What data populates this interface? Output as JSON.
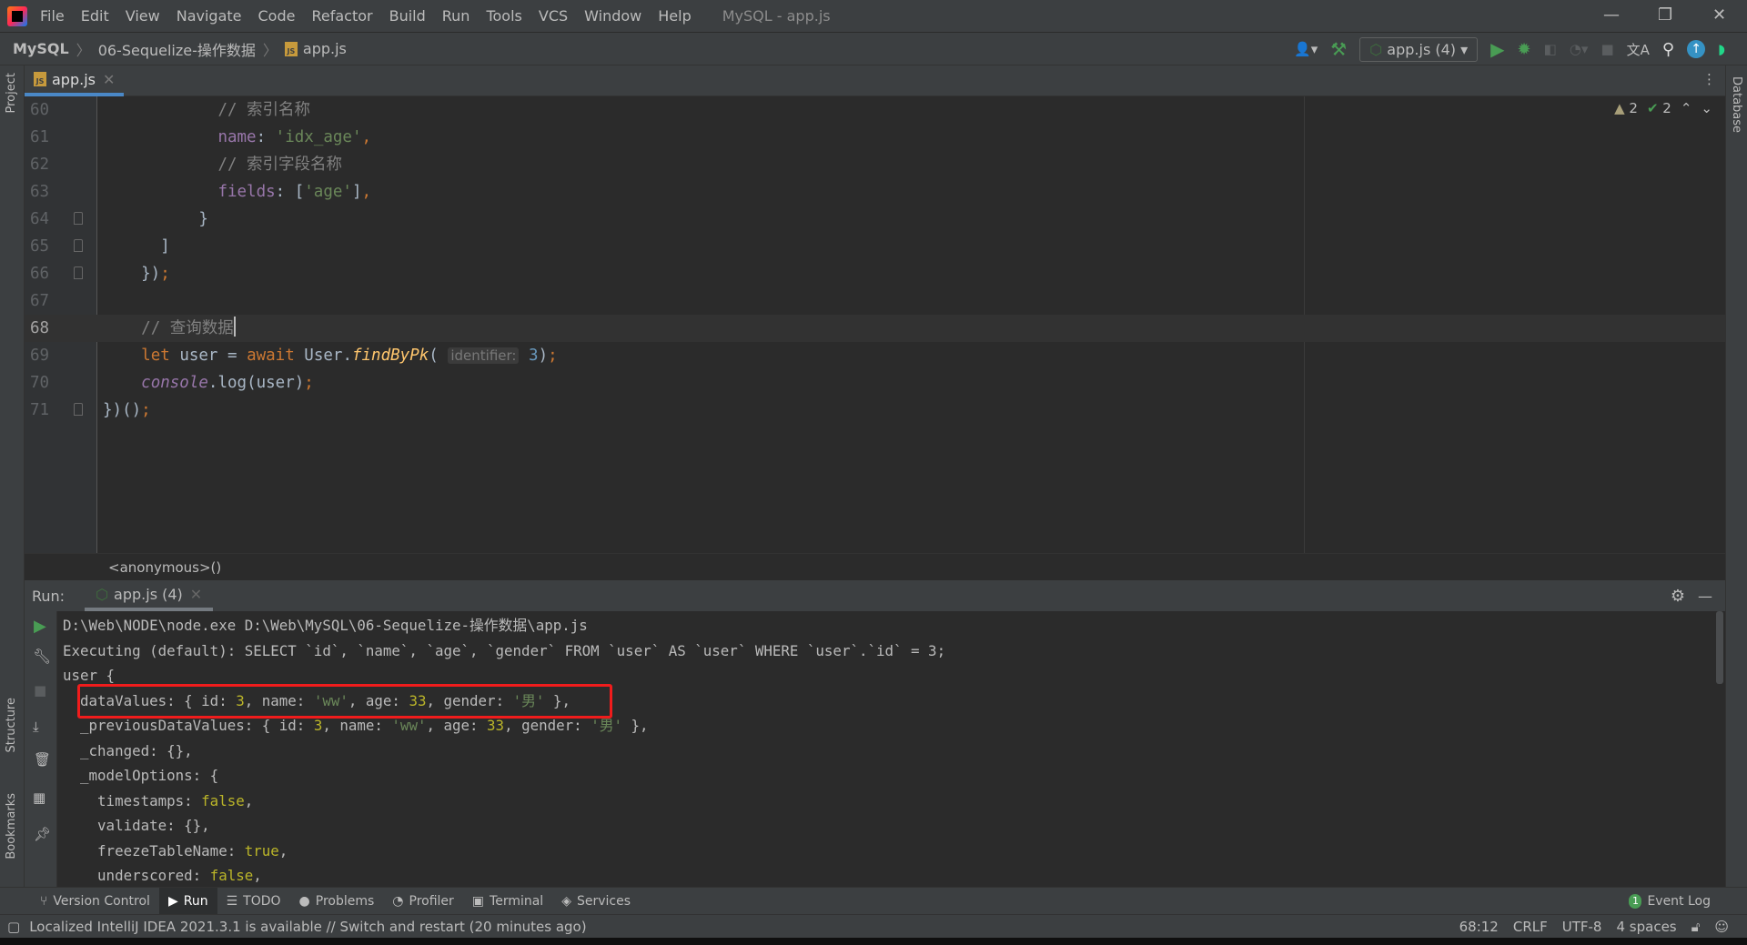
{
  "window": {
    "title": "MySQL - app.js"
  },
  "menu": [
    "File",
    "Edit",
    "View",
    "Navigate",
    "Code",
    "Refactor",
    "Build",
    "Run",
    "Tools",
    "VCS",
    "Window",
    "Help"
  ],
  "breadcrumb": [
    "MySQL",
    "06-Sequelize-操作数据",
    "app.js"
  ],
  "run_config": "app.js (4)",
  "editor_tab": "app.js",
  "side_labels": {
    "project": "Project",
    "structure": "Structure",
    "bookmarks": "Bookmarks",
    "database": "Database"
  },
  "inspections": {
    "warnings": "2",
    "ok": "2"
  },
  "code_lines": [
    {
      "n": "60",
      "tokens": [
        [
          "            ",
          "t-pl"
        ],
        [
          "// 索引名称",
          "t-cm"
        ]
      ]
    },
    {
      "n": "61",
      "tokens": [
        [
          "            ",
          "t-pl"
        ],
        [
          "name",
          "t-pr"
        ],
        [
          ": ",
          "t-pl"
        ],
        [
          "'idx_age'",
          "t-st"
        ],
        [
          ",",
          "t-kw"
        ]
      ]
    },
    {
      "n": "62",
      "tokens": [
        [
          "            ",
          "t-pl"
        ],
        [
          "// 索引字段名称",
          "t-cm"
        ]
      ]
    },
    {
      "n": "63",
      "tokens": [
        [
          "            ",
          "t-pl"
        ],
        [
          "fields",
          "t-pr"
        ],
        [
          ": [",
          "t-pl"
        ],
        [
          "'age'",
          "t-st"
        ],
        [
          "]",
          "t-pl"
        ],
        [
          ",",
          "t-kw"
        ]
      ]
    },
    {
      "n": "64",
      "tokens": [
        [
          "          }",
          "t-pl"
        ]
      ]
    },
    {
      "n": "65",
      "tokens": [
        [
          "      ]",
          "t-pl"
        ]
      ]
    },
    {
      "n": "66",
      "tokens": [
        [
          "    })",
          "t-pl"
        ],
        [
          ";",
          "t-kw"
        ]
      ]
    },
    {
      "n": "67",
      "tokens": []
    },
    {
      "n": "68",
      "tokens": [
        [
          "    ",
          "t-pl"
        ],
        [
          "// 查询数据",
          "t-cm"
        ]
      ]
    },
    {
      "n": "69",
      "tokens": [
        [
          "    ",
          "t-pl"
        ],
        [
          "let ",
          "t-kw"
        ],
        [
          "user = ",
          "t-pl"
        ],
        [
          "await ",
          "t-kw"
        ],
        [
          "User.",
          "t-pl"
        ],
        [
          "findByPk",
          "t-fn"
        ],
        [
          "( ",
          "t-pl"
        ],
        [
          "identifier:",
          "t-hint"
        ],
        [
          " ",
          "t-pl"
        ],
        [
          "3",
          "t-nm"
        ],
        [
          ")",
          "t-pl"
        ],
        [
          ";",
          "t-kw"
        ]
      ]
    },
    {
      "n": "70",
      "tokens": [
        [
          "    ",
          "t-pl"
        ],
        [
          "console",
          "t-gl"
        ],
        [
          ".log(user)",
          "t-pl"
        ],
        [
          ";",
          "t-kw"
        ]
      ]
    },
    {
      "n": "71",
      "tokens": [
        [
          "})()",
          "t-pl"
        ],
        [
          ";",
          "t-kw"
        ]
      ]
    }
  ],
  "current_line": "68",
  "code_breadcrumb": "<anonymous>()",
  "run": {
    "label": "Run:",
    "tab": "app.js (4)"
  },
  "console_lines": [
    [
      [
        "D:\\Web\\NODE\\node.exe D:\\Web\\MySQL\\06-Sequelize-操作数据\\app.js",
        ""
      ]
    ],
    [
      [
        "Executing (default): SELECT `id`, `name`, `age`, `gender` FROM `user` AS `user` WHERE `user`.`id` = 3;",
        ""
      ]
    ],
    [
      [
        "user {",
        ""
      ]
    ],
    [
      [
        "  dataValues: { id: ",
        ""
      ],
      [
        "3",
        "c-num"
      ],
      [
        ", name: ",
        ""
      ],
      [
        "'ww'",
        "c-str"
      ],
      [
        ", age: ",
        ""
      ],
      [
        "33",
        "c-num"
      ],
      [
        ", gender: ",
        ""
      ],
      [
        "'男'",
        "c-str"
      ],
      [
        " },",
        ""
      ]
    ],
    [
      [
        "  _previousDataValues: { id: ",
        ""
      ],
      [
        "3",
        "c-num"
      ],
      [
        ", name: ",
        ""
      ],
      [
        "'ww'",
        "c-str"
      ],
      [
        ", age: ",
        ""
      ],
      [
        "33",
        "c-num"
      ],
      [
        ", gender: ",
        ""
      ],
      [
        "'男'",
        "c-str"
      ],
      [
        " },",
        ""
      ]
    ],
    [
      [
        "  _changed: {},",
        ""
      ]
    ],
    [
      [
        "  _modelOptions: {",
        ""
      ]
    ],
    [
      [
        "    timestamps: ",
        ""
      ],
      [
        "false",
        "c-bool"
      ],
      [
        ",",
        ""
      ]
    ],
    [
      [
        "    validate: {},",
        ""
      ]
    ],
    [
      [
        "    freezeTableName: ",
        ""
      ],
      [
        "true",
        "c-bool"
      ],
      [
        ",",
        ""
      ]
    ],
    [
      [
        "    underscored: ",
        ""
      ],
      [
        "false",
        "c-bool"
      ],
      [
        ",",
        ""
      ]
    ]
  ],
  "tool_windows": [
    "Version Control",
    "Run",
    "TODO",
    "Problems",
    "Profiler",
    "Terminal",
    "Services"
  ],
  "event_log": {
    "count": "1",
    "label": "Event Log"
  },
  "status": {
    "message": "Localized IntelliJ IDEA 2021.3.1 is available // Switch and restart (20 minutes ago)",
    "position": "68:12",
    "line_ending": "CRLF",
    "encoding": "UTF-8",
    "indent": "4 spaces"
  },
  "colors": {
    "accent": "#4a88c7",
    "highlight_box": "#f01c1c",
    "run_green": "#499c54"
  }
}
